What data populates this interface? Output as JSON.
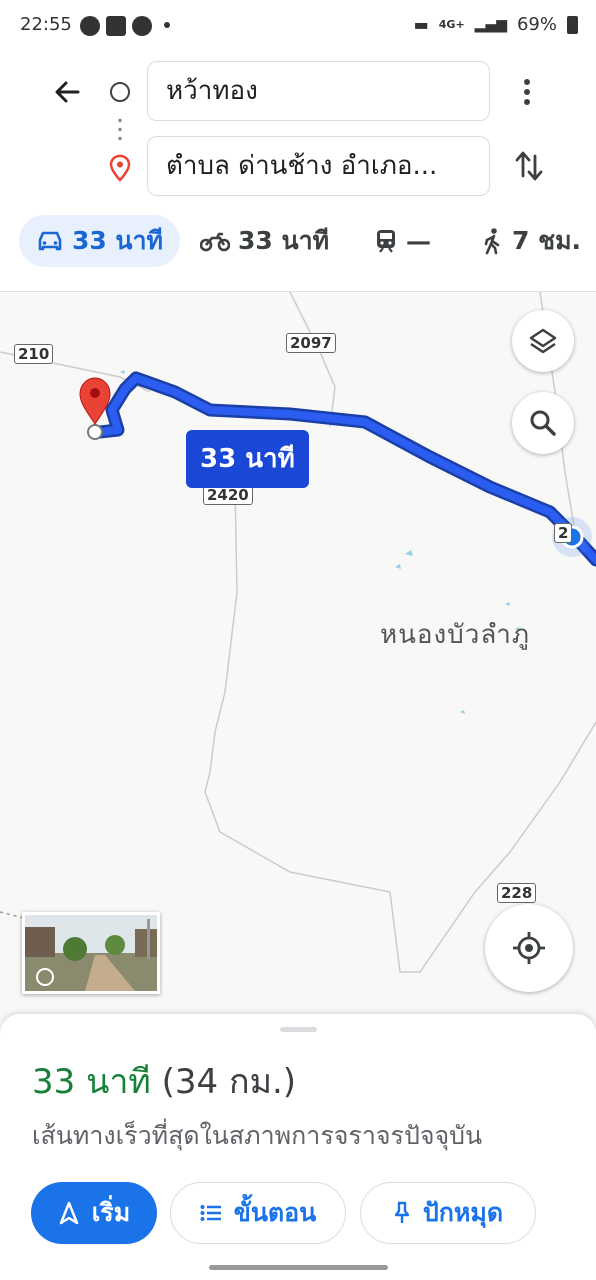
{
  "status_bar": {
    "time": "22:55",
    "network": "4G+",
    "battery": "69%"
  },
  "search": {
    "origin": "หว้าทอง",
    "destination": "ตำบล ด่านช้าง อำเภอ..."
  },
  "modes": [
    {
      "name": "drive",
      "label": "33 นาที",
      "icon": "car-icon",
      "active": true
    },
    {
      "name": "motorcycle",
      "label": "33 นาที",
      "icon": "motorcycle-icon"
    },
    {
      "name": "transit",
      "label": "—",
      "icon": "train-icon"
    },
    {
      "name": "walk",
      "label": "7 ชม.",
      "icon": "walk-icon"
    }
  ],
  "map": {
    "route_bubble": "33 นาที",
    "region_label": "หนองบัวลำภู",
    "road_shields": {
      "r210": "210",
      "r2097": "2097",
      "r2420": "2420",
      "r228": "228",
      "r2x": "2"
    },
    "colors": {
      "route": "#1a47d6",
      "pin": "#ea4335",
      "accent": "#1a73e8"
    }
  },
  "sheet": {
    "duration": "33 นาที",
    "distance": "(34 กม.)",
    "description": "เส้นทางเร็วที่สุดในสภาพการจราจรปัจจุบัน",
    "start_label": "เริ่ม",
    "steps_label": "ขั้นตอน",
    "pin_label": "ปักหมุด"
  }
}
